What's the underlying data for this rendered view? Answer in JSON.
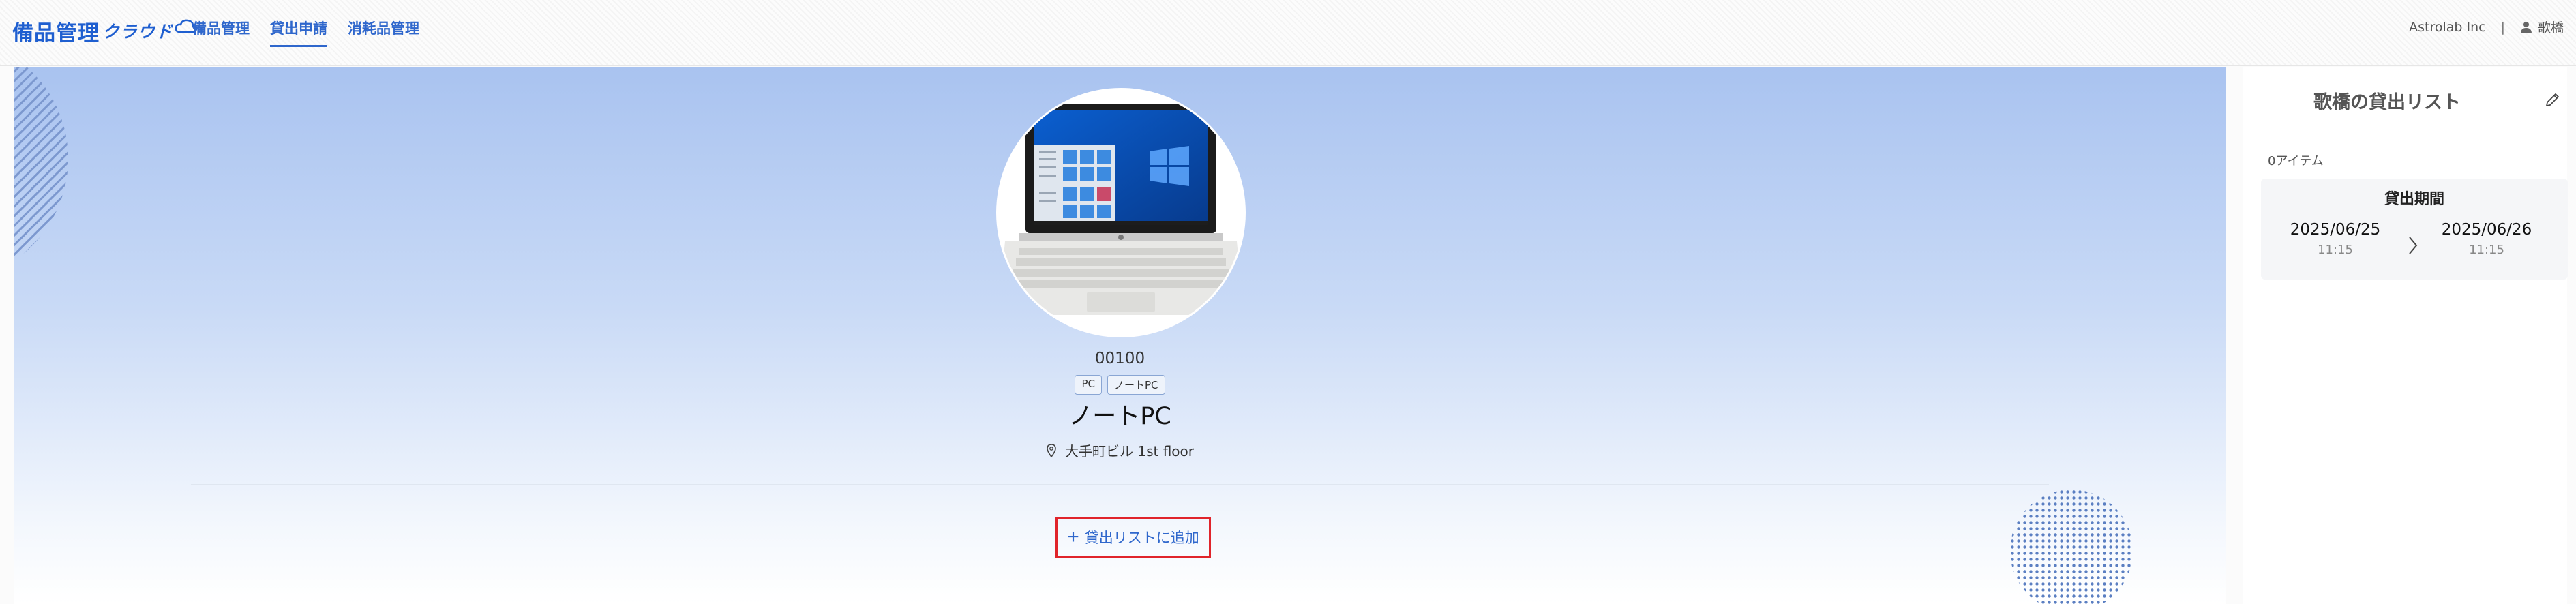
{
  "header": {
    "logo_text": "備品管理",
    "logo_suffix": "クラウド",
    "nav": [
      {
        "label": "備品管理",
        "active": false
      },
      {
        "label": "貸出申請",
        "active": true
      },
      {
        "label": "消耗品管理",
        "active": false
      }
    ],
    "company": "Astrolab Inc",
    "separator": "|",
    "user_name": "歌橋"
  },
  "item": {
    "code": "00100",
    "tags": [
      "PC",
      "ノートPC"
    ],
    "name": "ノートPC",
    "location": "大手町ビル 1st floor",
    "add_button_label": "貸出リストに追加"
  },
  "side": {
    "title": "歌橋の貸出リスト",
    "item_count": "0アイテム",
    "period": {
      "title": "貸出期間",
      "start_date": "2025/06/25",
      "start_time": "11:15",
      "end_date": "2025/06/26",
      "end_time": "11:15"
    }
  },
  "colors": {
    "accent": "#2f67cc",
    "highlight": "#e0242b"
  }
}
